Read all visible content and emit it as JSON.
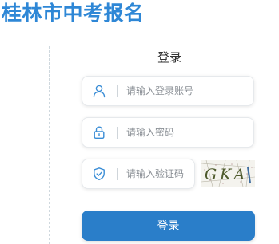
{
  "header": {
    "title": "桂林市中考报名"
  },
  "login": {
    "heading": "登录",
    "username": {
      "placeholder": "请输入登录账号",
      "value": "",
      "icon": "user-icon"
    },
    "password": {
      "placeholder": "请输入密码",
      "value": "",
      "icon": "lock-icon"
    },
    "captcha": {
      "placeholder": "请输入验证码",
      "value": "",
      "icon": "shield-icon",
      "image_text": "GKA"
    },
    "submit_label": "登录"
  },
  "colors": {
    "title": "#2e87d6",
    "icon": "#3a8dd6",
    "button": "#2a7ec9",
    "button_text": "#ffffff"
  }
}
